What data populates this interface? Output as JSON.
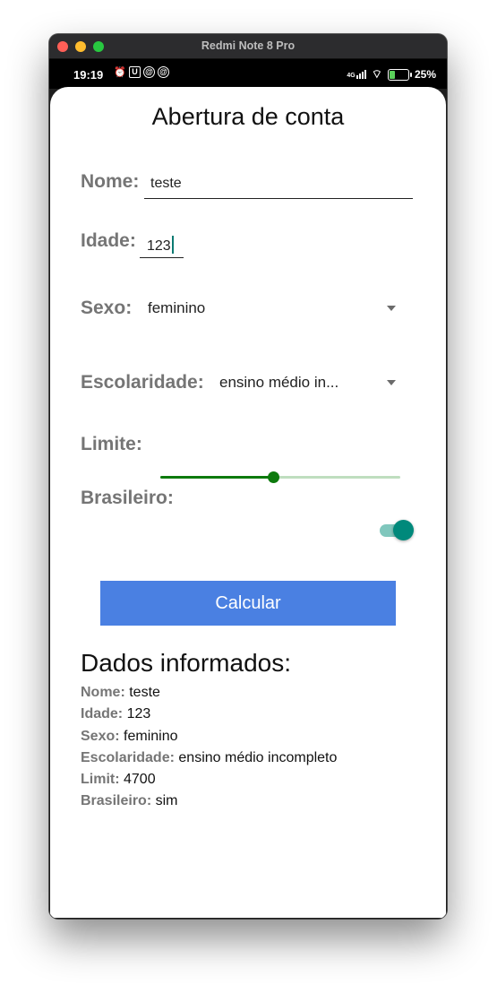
{
  "window": {
    "title": "Redmi Note 8 Pro"
  },
  "status": {
    "time": "19:19",
    "network": "4G",
    "battery": "25%"
  },
  "app": {
    "title": "Abertura de conta"
  },
  "form": {
    "nome": {
      "label": "Nome:",
      "value": "teste"
    },
    "idade": {
      "label": "Idade:",
      "value": "123"
    },
    "sexo": {
      "label": "Sexo:",
      "value": "feminino"
    },
    "escolaridade": {
      "label": "Escolaridade:",
      "value": "ensino médio in..."
    },
    "limite": {
      "label": "Limite:",
      "fraction": 0.47
    },
    "brasileiro": {
      "label": "Brasileiro:",
      "on": true
    },
    "button_label": "Calcular"
  },
  "summary": {
    "title": "Dados informados:",
    "rows": [
      {
        "key": "Nome:",
        "value": "teste"
      },
      {
        "key": "Idade:",
        "value": "123"
      },
      {
        "key": "Sexo:",
        "value": "feminino"
      },
      {
        "key": "Escolaridade:",
        "value": "ensino médio incompleto"
      },
      {
        "key": "Limit:",
        "value": "4700"
      },
      {
        "key": "Brasileiro:",
        "value": "sim"
      }
    ]
  },
  "colors": {
    "accent": "#4a80e2",
    "slider": "#0d7a0d",
    "switch": "#00897b"
  }
}
